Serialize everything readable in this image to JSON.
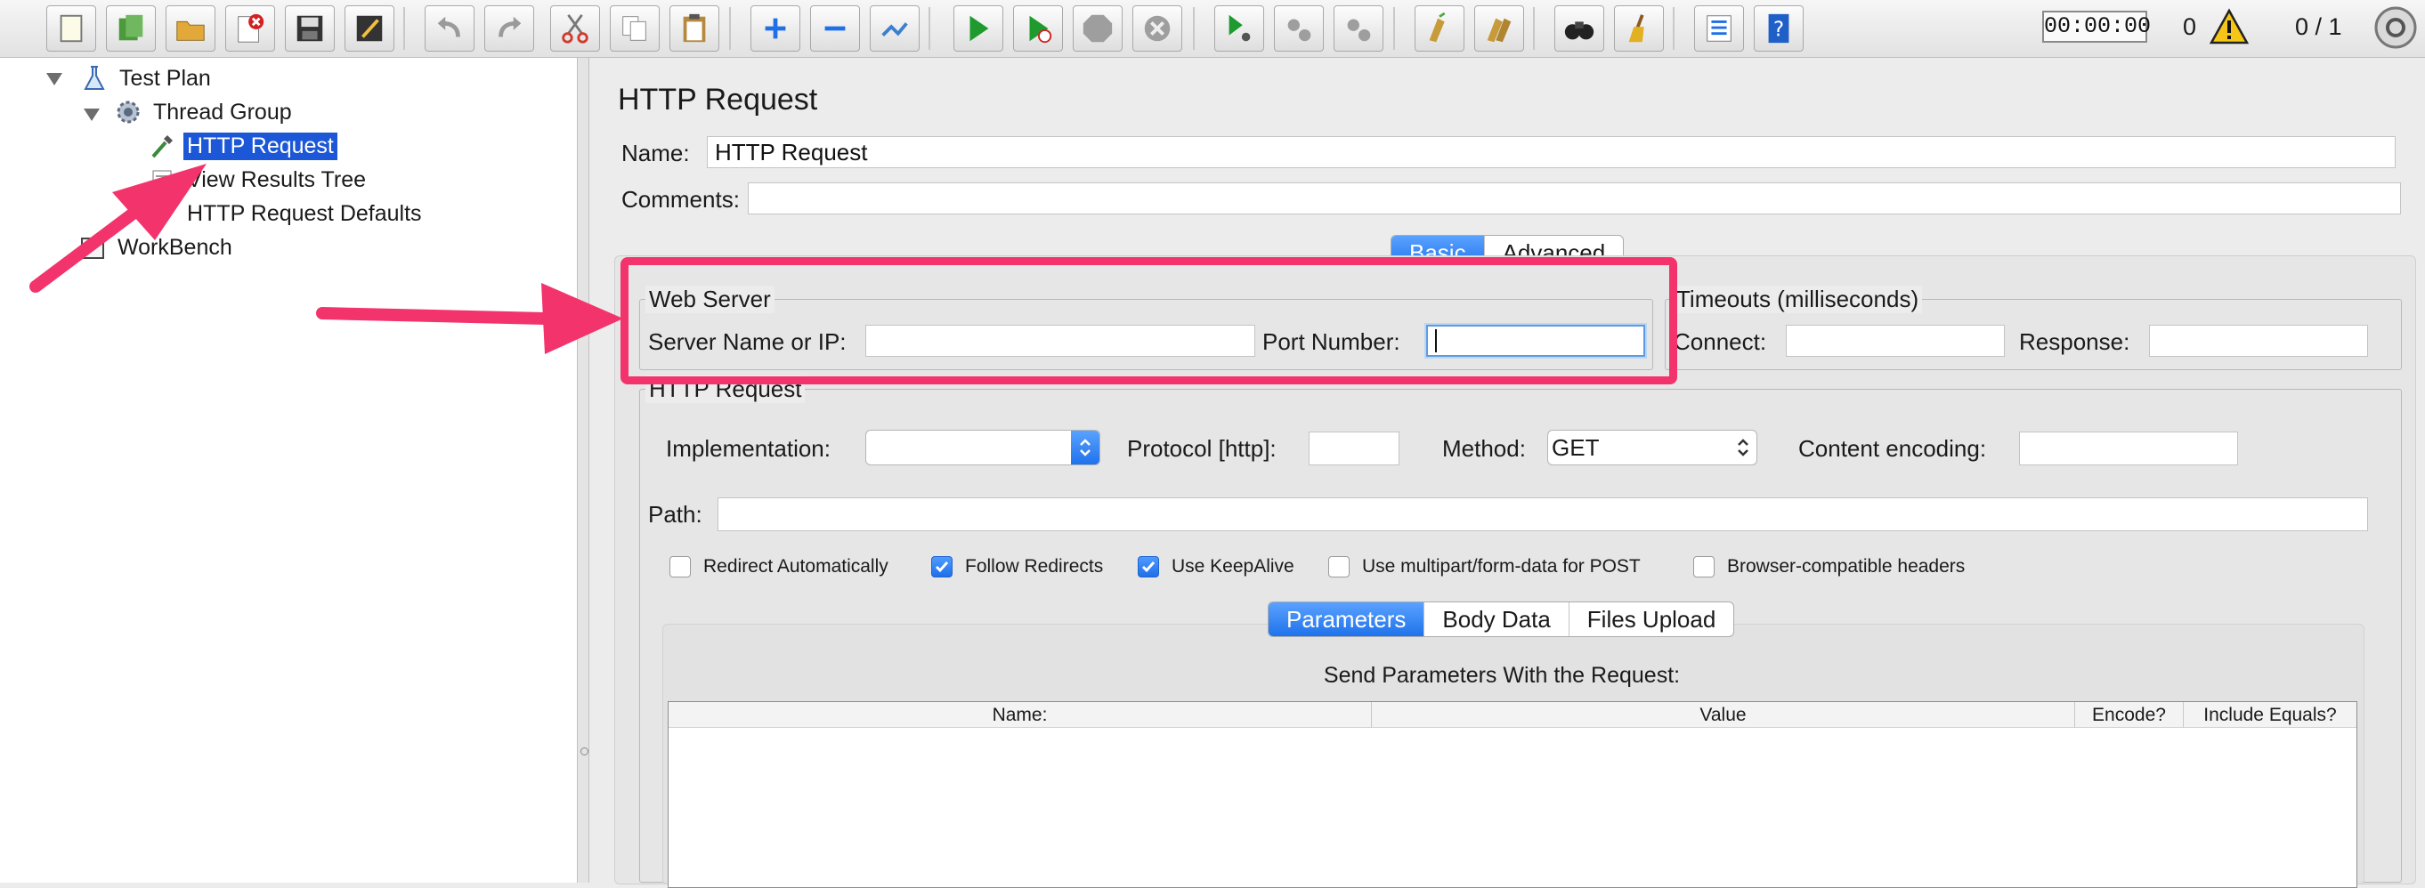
{
  "toolbar": {
    "buttons": [
      {
        "name": "new-icon",
        "color": "#f2f2d8"
      },
      {
        "name": "templates-icon",
        "color": "#4c9a3d"
      },
      {
        "name": "open-icon",
        "color": "#e2a93a"
      },
      {
        "name": "close-plan-icon",
        "color": "#d32020"
      },
      {
        "name": "save-icon",
        "color": "#333333"
      },
      {
        "name": "save-as-icon",
        "color": "#333333"
      },
      {
        "name": "undo-icon",
        "color": "#9a9a9a"
      },
      {
        "name": "redo-icon",
        "color": "#9a9a9a"
      },
      {
        "name": "cut-icon",
        "color": "#d23b2b"
      },
      {
        "name": "copy-icon",
        "color": "#8a8a8a"
      },
      {
        "name": "paste-icon",
        "color": "#8a6a30"
      },
      {
        "name": "expand-all-icon",
        "color": "#1e6fe8"
      },
      {
        "name": "collapse-all-icon",
        "color": "#1e6fe8"
      },
      {
        "name": "toggle-icon",
        "color": "#3a7fd0"
      },
      {
        "name": "start-icon",
        "color": "#1f9a2f"
      },
      {
        "name": "start-no-pauses-icon",
        "color": "#1f9a2f"
      },
      {
        "name": "stop-icon",
        "color": "#9e9e9e"
      },
      {
        "name": "shutdown-icon",
        "color": "#9e9e9e"
      },
      {
        "name": "remote-start-icon",
        "color": "#1f9a2f"
      },
      {
        "name": "remote-stop-icon",
        "color": "#9e9e9e"
      },
      {
        "name": "remote-shutdown-icon",
        "color": "#9e9e9e"
      },
      {
        "name": "clear-icon",
        "color": "#c79a3a"
      },
      {
        "name": "clear-all-icon",
        "color": "#c79a3a"
      },
      {
        "name": "search-icon",
        "color": "#222222"
      },
      {
        "name": "reset-search-icon",
        "color": "#e2b020"
      },
      {
        "name": "function-helper-icon",
        "color": "#1e6fe8"
      },
      {
        "name": "help-icon",
        "color": "#1e5fc8"
      }
    ],
    "timer": "00:00:00",
    "error_count": "0",
    "threads": "0 / 1",
    "warning_color": "#f5c518"
  },
  "tree": {
    "items": [
      {
        "label": "Test Plan",
        "icon": "flask-icon"
      },
      {
        "label": "Thread Group",
        "icon": "gear-icon"
      },
      {
        "label": "HTTP Request",
        "icon": "pipette-icon",
        "selected": true
      },
      {
        "label": "View Results Tree",
        "icon": "listener-icon"
      },
      {
        "label": "HTTP Request Defaults",
        "icon": "wrench-icon"
      },
      {
        "label": "WorkBench",
        "icon": "workbench-icon"
      }
    ],
    "selection_color": "#1b57d6"
  },
  "panel": {
    "title": "HTTP Request",
    "name_label": "Name:",
    "name_value": "HTTP Request",
    "comments_label": "Comments:",
    "comments_value": "",
    "tabs": [
      "Basic",
      "Advanced"
    ],
    "active_tab": "Basic",
    "web_server": {
      "title": "Web Server",
      "server_label": "Server Name or IP:",
      "server_value": "",
      "port_label": "Port Number:",
      "port_value": ""
    },
    "timeouts": {
      "title": "Timeouts (milliseconds)",
      "connect_label": "Connect:",
      "connect_value": "",
      "response_label": "Response:",
      "response_value": ""
    },
    "http_request": {
      "title": "HTTP Request",
      "implementation_label": "Implementation:",
      "implementation_value": "",
      "protocol_label": "Protocol [http]:",
      "protocol_value": "",
      "method_label": "Method:",
      "method_value": "GET",
      "encoding_label": "Content encoding:",
      "encoding_value": "",
      "path_label": "Path:",
      "path_value": ""
    },
    "checkboxes": [
      {
        "label": "Redirect Automatically",
        "checked": false
      },
      {
        "label": "Follow Redirects",
        "checked": true
      },
      {
        "label": "Use KeepAlive",
        "checked": true
      },
      {
        "label": "Use multipart/form-data for POST",
        "checked": false
      },
      {
        "label": "Browser-compatible headers",
        "checked": false
      }
    ],
    "param_tabs": [
      "Parameters",
      "Body Data",
      "Files Upload"
    ],
    "active_param_tab": "Parameters",
    "params_title": "Send Parameters With the Request:",
    "params_columns": [
      "Name:",
      "Value",
      "Encode?",
      "Include Equals?"
    ]
  },
  "annotation": {
    "color": "#f2336c"
  }
}
